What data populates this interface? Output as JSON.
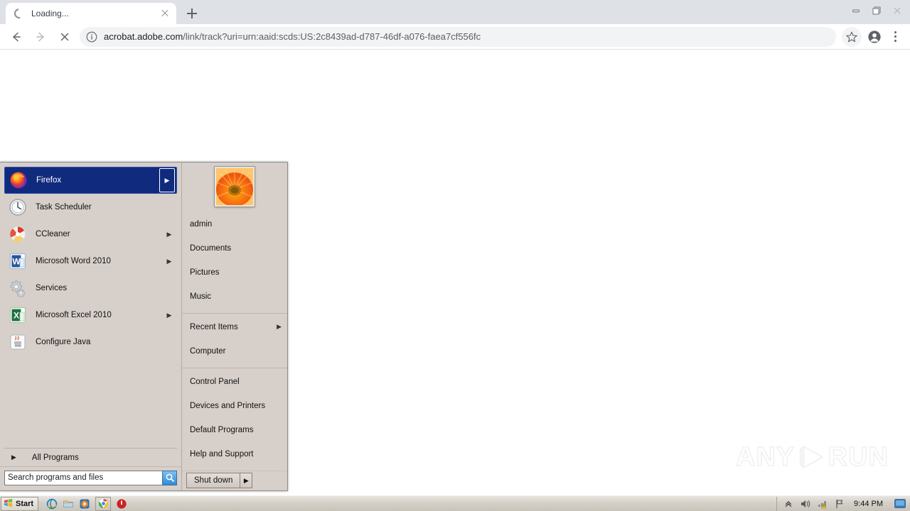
{
  "browser": {
    "tab": {
      "title": "Loading...",
      "favicon": "spinner-icon",
      "close": "×"
    },
    "newtab_tooltip": "New Tab",
    "window_controls": {
      "minimize": "minimize-icon",
      "restore": "restore-icon",
      "close": "close-icon"
    },
    "toolbar": {
      "back": "back-arrow-icon",
      "forward": "forward-arrow-icon",
      "stop": "stop-icon",
      "site_info": "info-circle-icon",
      "url_host": "acrobat.adobe.com",
      "url_path": "/link/track?uri=urn:aaid:scds:US:2c8439ad-d787-46df-a076-faea7cf556fc",
      "url_full": "acrobat.adobe.com/link/track?uri=urn:aaid:scds:US:2c8439ad-d787-46df-a076-faea7cf556fc",
      "bookmark": "star-icon",
      "profile": "profile-avatar-icon",
      "menu": "three-dots-menu-icon"
    }
  },
  "watermark": {
    "left": "ANY",
    "right": "RUN",
    "logo": "play-triangle-logo"
  },
  "start_menu": {
    "programs": [
      {
        "label": "Firefox",
        "icon": "firefox-icon",
        "arrow": true,
        "selected": true
      },
      {
        "label": "Task Scheduler",
        "icon": "clock-icon",
        "arrow": false,
        "selected": false
      },
      {
        "label": "CCleaner",
        "icon": "ccleaner-icon",
        "arrow": true,
        "selected": false
      },
      {
        "label": "Microsoft Word 2010",
        "icon": "word-icon",
        "arrow": true,
        "selected": false
      },
      {
        "label": "Services",
        "icon": "gears-icon",
        "arrow": false,
        "selected": false
      },
      {
        "label": "Microsoft Excel 2010",
        "icon": "excel-icon",
        "arrow": true,
        "selected": false
      },
      {
        "label": "Configure Java",
        "icon": "java-icon",
        "arrow": false,
        "selected": false
      }
    ],
    "all_programs": {
      "label": "All Programs",
      "arrow": "▶"
    },
    "search": {
      "placeholder": "Search programs and files",
      "value": "",
      "button_icon": "magnifier-icon"
    },
    "user": {
      "name": "admin",
      "avatar": "orange-flower-avatar"
    },
    "right_groups": [
      {
        "items": [
          {
            "label": "Documents",
            "arrow": false
          },
          {
            "label": "Pictures",
            "arrow": false
          },
          {
            "label": "Music",
            "arrow": false
          }
        ]
      },
      {
        "items": [
          {
            "label": "Recent Items",
            "arrow": true
          },
          {
            "label": "Computer",
            "arrow": false
          }
        ]
      },
      {
        "items": [
          {
            "label": "Control Panel",
            "arrow": false
          },
          {
            "label": "Devices and Printers",
            "arrow": false
          },
          {
            "label": "Default Programs",
            "arrow": false
          },
          {
            "label": "Help and Support",
            "arrow": false
          }
        ]
      }
    ],
    "shutdown": {
      "label": "Shut down",
      "arrow": "▶"
    }
  },
  "taskbar": {
    "start_label": "Start",
    "start_icon": "windows-flag-icon",
    "quick_launch": [
      {
        "name": "internet-explorer-icon",
        "active": false
      },
      {
        "name": "windows-explorer-icon",
        "active": false
      },
      {
        "name": "media-player-icon",
        "active": false
      },
      {
        "name": "google-chrome-icon",
        "active": true
      },
      {
        "name": "red-power-icon",
        "active": false
      }
    ],
    "tray": [
      {
        "name": "show-hidden-icons-icon"
      },
      {
        "name": "volume-icon"
      },
      {
        "name": "network-warning-icon"
      },
      {
        "name": "action-center-flag-icon"
      }
    ],
    "clock": "9:44 PM",
    "show_desktop": "show-desktop-button"
  },
  "colors": {
    "start_menu_bg": "#d6cfca",
    "selection_blue": "#102a7d",
    "chrome_tabstrip": "#dee1e6",
    "omnibox_bg": "#f1f3f4",
    "taskbar_bg": "#d4d0c8"
  }
}
